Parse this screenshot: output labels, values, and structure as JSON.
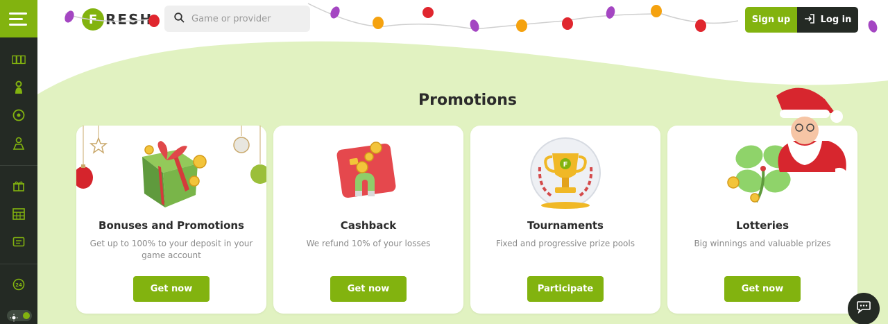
{
  "header": {
    "logo_text": "RESH",
    "logo_letter": "F",
    "search_placeholder": "Game or provider",
    "signup_label": "Sign up",
    "login_label": "Log in"
  },
  "sidebar": {
    "icons": [
      "slots-icon",
      "live-dealer-icon",
      "sports-ball-icon",
      "esports-controller-icon",
      "gift-icon",
      "calendar-icon",
      "tournament-ticket-icon",
      "support-24-icon"
    ],
    "theme_icon": "sun-icon"
  },
  "page": {
    "title": "Promotions"
  },
  "cards": [
    {
      "title": "Bonuses and Promotions",
      "desc": "Get up to 100% to your deposit in your game account",
      "button": "Get now",
      "icon": "gift-box-icon"
    },
    {
      "title": "Cashback",
      "desc": "We refund 10% of your losses",
      "button": "Get now",
      "icon": "cashback-magnet-icon"
    },
    {
      "title": "Tournaments",
      "desc": "Fixed and progressive prize pools",
      "button": "Participate",
      "icon": "trophy-icon"
    },
    {
      "title": "Lotteries",
      "desc": "Big winnings and valuable prizes",
      "button": "Get now",
      "icon": "clover-icon"
    }
  ],
  "colors": {
    "accent": "#82b30f",
    "dark": "#242a24",
    "background": "#e1f2c1"
  }
}
